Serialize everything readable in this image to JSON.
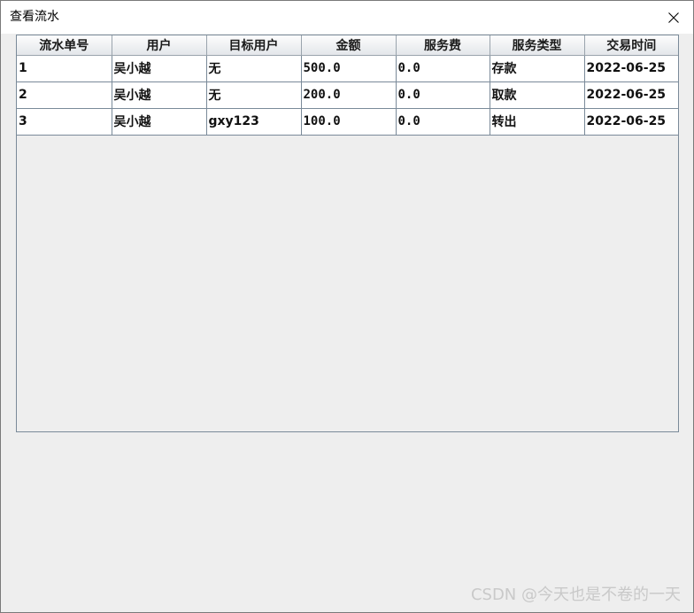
{
  "window": {
    "title": "查看流水"
  },
  "icons": {
    "close": "close-icon"
  },
  "table": {
    "columns": [
      "流水单号",
      "用户",
      "目标用户",
      "金额",
      "服务费",
      "服务类型",
      "交易时间"
    ],
    "rows": [
      [
        "1",
        "吴小越",
        "无",
        "500.0",
        "0.0",
        "存款",
        "2022-06-25"
      ],
      [
        "2",
        "吴小越",
        "无",
        "200.0",
        "0.0",
        "取款",
        "2022-06-25"
      ],
      [
        "3",
        "吴小越",
        "gxy123",
        "100.0",
        "0.0",
        "转出",
        "2022-06-25"
      ]
    ]
  },
  "watermark": "CSDN @今天也是不卷的一天"
}
